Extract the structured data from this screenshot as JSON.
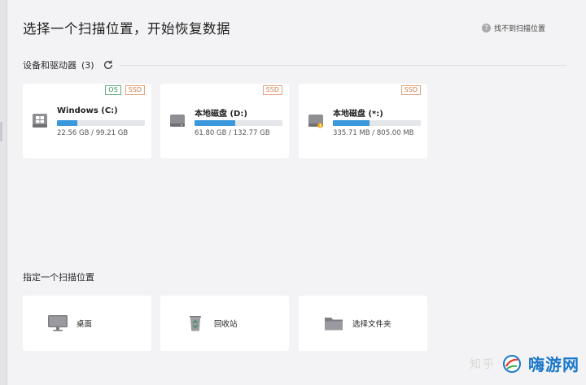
{
  "header": {
    "title": "选择一个扫描位置，开始恢复数据",
    "help_label": "找不到扫描位置",
    "help_icon": "question-circle-icon"
  },
  "devices": {
    "section_label": "设备和驱动器",
    "count_label": "(3)",
    "refresh_icon": "refresh-icon",
    "drives": [
      {
        "name": "Windows (C:)",
        "size": "22.56 GB / 99.21 GB",
        "used_fraction": 0.227,
        "badges": [
          "OS",
          "SSD"
        ],
        "icon": "windows-drive-icon"
      },
      {
        "name": "本地磁盘 (D:)",
        "size": "61.80 GB / 132.77 GB",
        "used_fraction": 0.465,
        "badges": [
          "SSD"
        ],
        "icon": "hard-drive-icon"
      },
      {
        "name": "本地磁盘 (*:)",
        "size": "335.71 MB / 805.00 MB",
        "used_fraction": 0.417,
        "badges": [
          "SSD"
        ],
        "icon": "hard-drive-warning-icon"
      }
    ]
  },
  "location": {
    "section_label": "指定一个扫描位置",
    "items": [
      {
        "label": "桌面",
        "icon": "desktop-monitor-icon"
      },
      {
        "label": "回收站",
        "icon": "recycle-bin-icon"
      },
      {
        "label": "选择文件夹",
        "icon": "folder-icon"
      }
    ]
  },
  "watermark": {
    "zhihu": "知乎",
    "site": "嗨游网"
  },
  "colors": {
    "accent": "#3b98dc",
    "os_badge": "#2e8b57",
    "ssd_badge": "#cf7a45",
    "background": "#f3f3f5"
  }
}
